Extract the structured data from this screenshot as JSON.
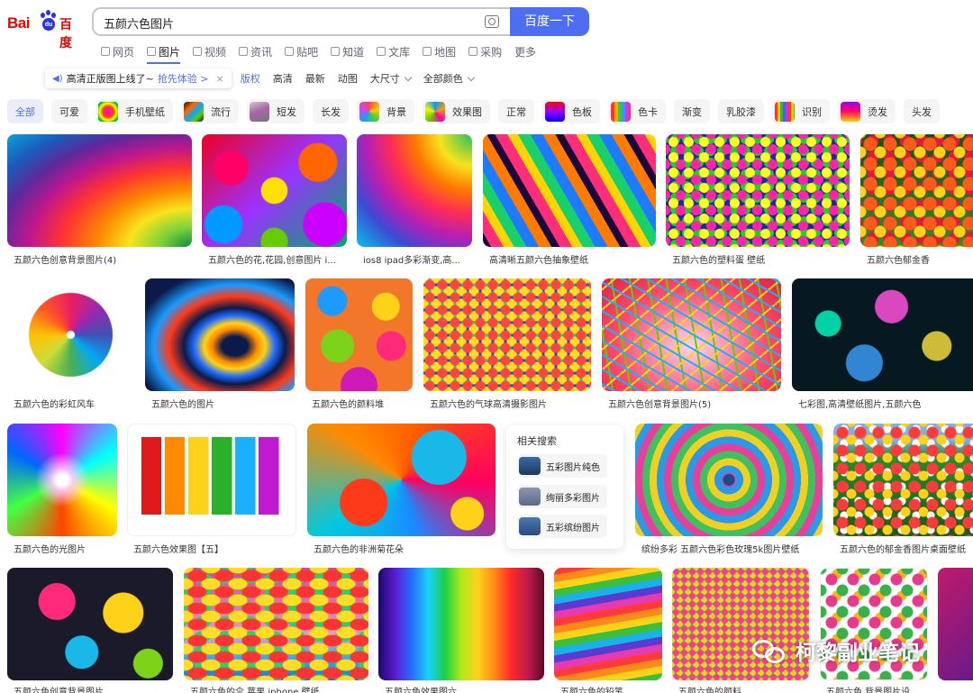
{
  "header": {
    "logo_text_latin": "Bai",
    "logo_paw_text": "du",
    "logo_text_cn": "百度",
    "search_query": "五颜六色图片",
    "search_button": "百度一下"
  },
  "nav_tabs": [
    {
      "label": "网页"
    },
    {
      "label": "图片"
    },
    {
      "label": "视频"
    },
    {
      "label": "资讯"
    },
    {
      "label": "贴吧"
    },
    {
      "label": "知道"
    },
    {
      "label": "文库"
    },
    {
      "label": "地图"
    },
    {
      "label": "采购"
    },
    {
      "label": "更多"
    }
  ],
  "filters": {
    "notice_text": "高清正版图上线了~",
    "notice_link": "抢先体验 >",
    "notice_close": "×",
    "items": [
      "版权",
      "高清",
      "最新",
      "动图"
    ],
    "size": "大尺寸",
    "color": "全部颜色"
  },
  "tags": [
    "全部",
    "可爱",
    "手机壁纸",
    "流行",
    "短发",
    "长发",
    "背景",
    "效果图",
    "正常",
    "色板",
    "色卡",
    "渐变",
    "乳胶漆",
    "识别",
    "烫发",
    "头发"
  ],
  "results": [
    {
      "caption": "五颜六色创意背景图片(4)"
    },
    {
      "caption": "五颜六色的花,花园,创意图片 i..."
    },
    {
      "caption": "ios8 ipad多彩渐变,高..."
    },
    {
      "caption": "高清晰五颜六色抽象壁纸"
    },
    {
      "caption": "五颜六色的塑料蛋 壁纸"
    },
    {
      "caption": "五颜六色郁金香"
    },
    {
      "caption": "五颜六色的彩虹风车"
    },
    {
      "caption": "五颜六色的图片"
    },
    {
      "caption": "五颜六色的颜料堆"
    },
    {
      "caption": "五颜六色的气球高清摄影图片"
    },
    {
      "caption": "五颜六色创意背景图片(5)"
    },
    {
      "caption": "七彩图,高清壁纸图片,五颜六色"
    },
    {
      "caption": "五颜六色的光图片"
    },
    {
      "caption": "五颜六色效果图【五】"
    },
    {
      "caption": "五颜六色的非洲菊花朵"
    },
    {
      "caption": "缤纷多彩 五颜六色彩色玫瑰5k图片壁纸"
    },
    {
      "caption": "五颜六色的郁金香图片桌面壁纸"
    },
    {
      "caption": "五颜六色创意背景图片"
    },
    {
      "caption": "五颜六色的伞 苹果 iphone 壁纸"
    },
    {
      "caption": "五颜六色效果图六"
    },
    {
      "caption": "五颜六色的铅笔"
    },
    {
      "caption": "五颜六色的颜料"
    },
    {
      "caption": "五颜六色 背景图片设"
    }
  ],
  "related": {
    "title": "相关搜索",
    "items": [
      "五彩图片纯色",
      "绚丽多彩图片",
      "五彩缤纷图片"
    ]
  },
  "watermark": "柯黎副业笔记",
  "colors": {
    "accent": "#4e6ef2",
    "brand_red": "#e10601",
    "brand_blue": "#2932e1"
  }
}
